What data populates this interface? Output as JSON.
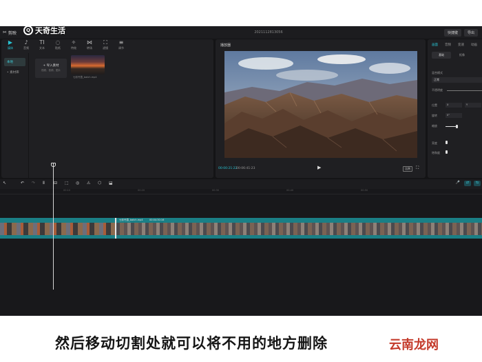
{
  "app": {
    "logo_glyph": "✂",
    "name": "剪映",
    "project_title": "2021112813056",
    "buttons": [
      "快捷键",
      "导出"
    ]
  },
  "media": {
    "tabs": [
      {
        "icon": "▶",
        "label": "媒体",
        "active": true
      },
      {
        "icon": "♪",
        "label": "音频",
        "active": false
      },
      {
        "icon": "TI",
        "label": "文本",
        "active": false
      },
      {
        "icon": "◌",
        "label": "贴纸",
        "active": false
      },
      {
        "icon": "✧",
        "label": "特效",
        "active": false
      },
      {
        "icon": "⋈",
        "label": "转场",
        "active": false
      },
      {
        "icon": "⛶",
        "label": "滤镜",
        "active": false
      },
      {
        "icon": "≡",
        "label": "调节",
        "active": false
      }
    ],
    "side": [
      "本地",
      "• 素材库"
    ],
    "import_label": "+ 导入素材",
    "import_sub": "视频、音频、图片",
    "thumb_caption": "七彩丹霞_batch.mp4"
  },
  "player": {
    "title": "播放器",
    "time_current": "00:00:21:22",
    "time_total": "00:06:41:23",
    "play_icon": "▶",
    "ratio": "比例",
    "fullscreen_icon": "⛶"
  },
  "props": {
    "tabs": [
      "画面",
      "音频",
      "变速",
      "动画"
    ],
    "subtabs": [
      "基础",
      "抠像"
    ],
    "labels": {
      "blend": "混合模式",
      "blend_value": "正常",
      "opacity": "不透明度",
      "position": "位置",
      "rotation": "旋转",
      "scale": "缩放",
      "brightness": "亮度",
      "saturation": "饱和度"
    },
    "pos_x": "X",
    "pos_y": "Y",
    "rotation_value": "0°"
  },
  "timeline": {
    "tools": [
      "↖",
      "↶",
      "↷",
      "Ⅱ",
      "⊟",
      "⬚",
      "◎",
      "⚠",
      "⬡",
      "⬓"
    ],
    "right_tools": [
      "🎤",
      "⇄",
      "⇆"
    ],
    "ruler": [
      "00:10",
      "00:20",
      "00:30",
      "00:40",
      "00:50"
    ],
    "clip_name": "七彩丹霞_batch.mp4",
    "clip_duration": "00:04:30:16"
  },
  "overlay": {
    "subtitle": "然后移动切割处就可以将不用的地方删除",
    "watermark_top": "天奇生活",
    "watermark_bottom": "云南龙网"
  }
}
